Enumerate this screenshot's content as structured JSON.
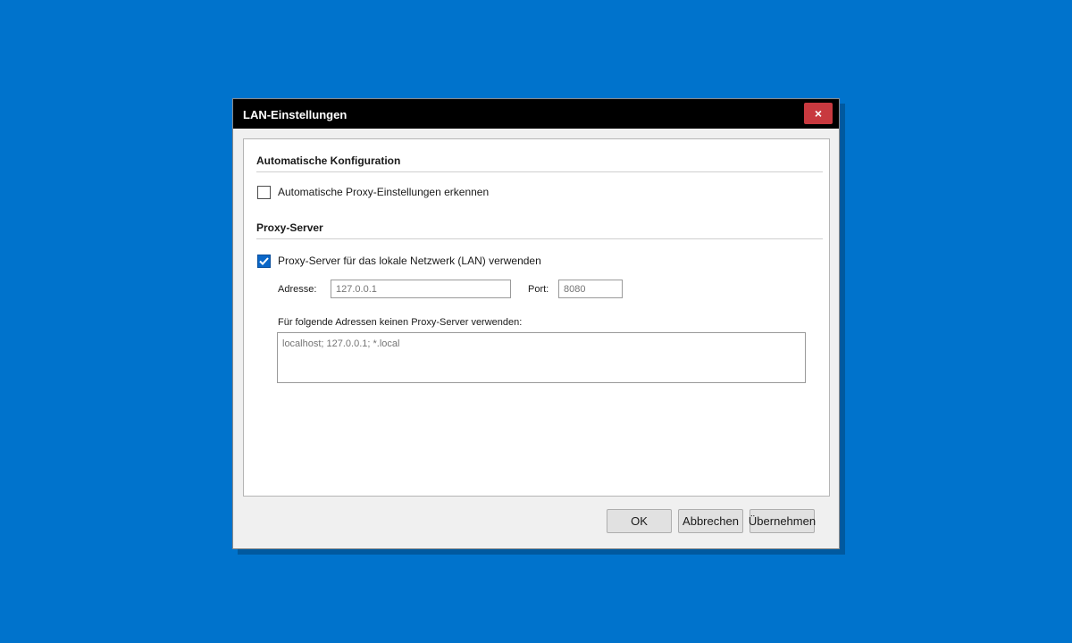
{
  "window": {
    "title": "LAN-Einstellungen",
    "close_symbol": "×"
  },
  "auto_config": {
    "heading": "Automatische Konfiguration",
    "detect_label": "Automatische Proxy-Einstellungen erkennen",
    "detect_checked": false
  },
  "proxy": {
    "heading": "Proxy-Server",
    "use_proxy_label": "Proxy-Server für das lokale Netzwerk (LAN) verwenden",
    "use_proxy_checked": true,
    "address_label": "Adresse:",
    "address_placeholder": "127.0.0.1",
    "port_label": "Port:",
    "port_placeholder": "8080",
    "bypass_label": "Für folgende Adressen keinen Proxy-Server verwenden:",
    "bypass_placeholder": "localhost; 127.0.0.1; *.local"
  },
  "buttons": {
    "ok": "OK",
    "cancel": "Abbrechen",
    "apply": "Übernehmen"
  },
  "colors": {
    "desktop": "#0073cc",
    "titlebar": "#000000",
    "close_button": "#c8393f",
    "checkbox_checked": "#0a67c8"
  },
  "icons": {
    "close": "close-icon",
    "checkmark": "checkmark-icon"
  }
}
